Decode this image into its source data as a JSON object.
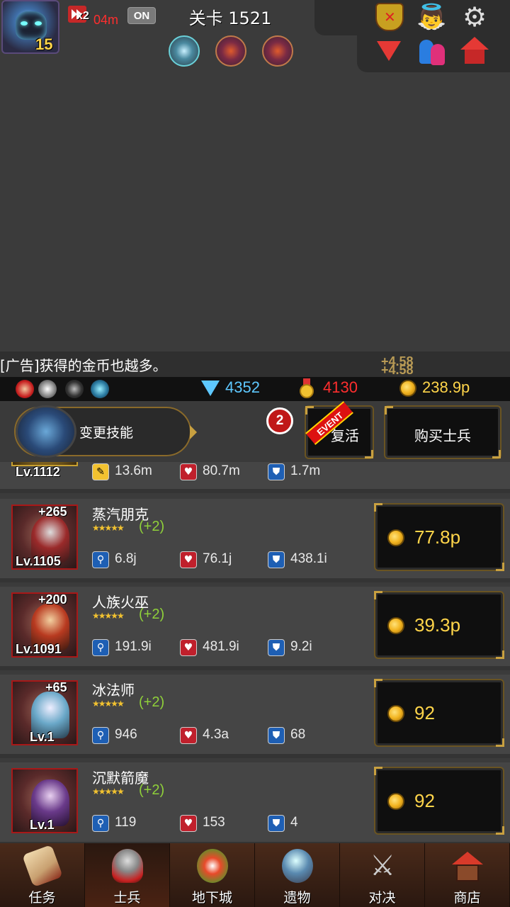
{
  "hud": {
    "hero_level": "15",
    "speed_multiplier": "x2",
    "speed_timer": "04m",
    "auto_toggle": "ON",
    "stage_title": "关卡 1521",
    "boss_icons": [
      "storm-boss-icon",
      "flower-boss-icon",
      "flower-boss-icon"
    ]
  },
  "message": {
    "text": "[广告]获得的金币也越多。",
    "floating_gain": [
      "+4.58",
      "+4.58"
    ]
  },
  "resources": {
    "gems": "4352",
    "medals": "4130",
    "gold": "238.9p"
  },
  "actions": {
    "skill_label": "变更技能",
    "notification_count": "2",
    "event_tag": "EVENT",
    "revive_label": "复活",
    "buy_label": "购买士兵"
  },
  "partial_row": {
    "level": "Lv.1112",
    "atk": "13.6m",
    "hp": "80.7m",
    "def": "1.7m"
  },
  "soldiers": [
    {
      "name": "蒸汽朋克",
      "bonus": "+265",
      "level": "Lv.1105",
      "stars": "★★★★★",
      "plus": "(+2)",
      "atk": "6.8j",
      "hp": "76.1j",
      "def": "438.1i",
      "price": "77.8p"
    },
    {
      "name": "人族火巫",
      "bonus": "+200",
      "level": "Lv.1091",
      "stars": "★★★★★",
      "plus": "(+2)",
      "atk": "191.9i",
      "hp": "481.9i",
      "def": "9.2i",
      "price": "39.3p"
    },
    {
      "name": "冰法师",
      "bonus": "+65",
      "level": "Lv.1",
      "stars": "★★★★★",
      "plus": "(+2)",
      "atk": "946",
      "hp": "4.3a",
      "def": "68",
      "price": "92"
    },
    {
      "name": "沉默箭魔",
      "bonus": "",
      "level": "Lv.1",
      "stars": "★★★★★",
      "plus": "(+2)",
      "atk": "119",
      "hp": "153",
      "def": "4",
      "price": "92"
    }
  ],
  "nav": [
    {
      "label": "任务",
      "icon": "scroll-icon"
    },
    {
      "label": "士兵",
      "icon": "helmet-icon"
    },
    {
      "label": "地下城",
      "icon": "monster-plant-icon"
    },
    {
      "label": "遗物",
      "icon": "orb-icon"
    },
    {
      "label": "对决",
      "icon": "crossed-swords-icon"
    },
    {
      "label": "商店",
      "icon": "shop-icon"
    }
  ],
  "colors": {
    "gold_text": "#ffd54a",
    "gem_text": "#5ec8ff",
    "medal_text": "#ff2e2e",
    "plus_text": "#8fd03a"
  }
}
